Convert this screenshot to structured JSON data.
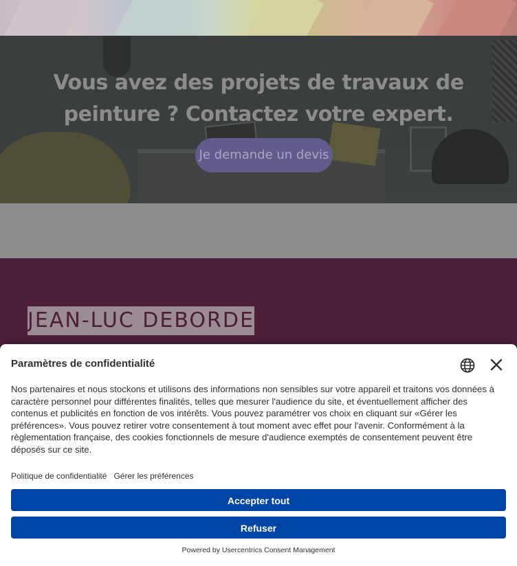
{
  "hero": {
    "title": "Vous avez des projets de travaux de peinture ? Contactez votre expert.",
    "cta_label": "Je demande un devis"
  },
  "footer": {
    "logo_text": "JEAN-LUC DEBORDE"
  },
  "consent": {
    "title": "Paramètres de confidentialité",
    "language_icon": "globe-icon",
    "close_icon": "close-icon",
    "body": "Nos partenaires et nous stockons et utilisons des informations non sensibles sur votre appareil et traitons vos données à caractère personnel pour différentes finalités, telles que mesurer l'audience du site, et éventuellement afficher des contenus et publicités en fonction de vos intérêts. Vous pouvez paramétrer vos choix en cliquant sur «Gérer les préférences». Vous pouvez retirer votre consentement à tout moment avec effet pour l'avenir. Conformément à la règlementation française, des cookies fonctionnels de mesure d'audience exemptés de consentement peuvent être déposés sur ce site.",
    "links": {
      "privacy_policy": "Politique de confidentialité",
      "manage_preferences": "Gérer les préférences"
    },
    "accept_label": "Accepter tout",
    "deny_label": "Refuser",
    "powered_by": "Powered by Usercentrics Consent Management",
    "colors": {
      "button_bg": "#0045a5",
      "button_text": "#ffffff",
      "text": "#303030"
    }
  }
}
